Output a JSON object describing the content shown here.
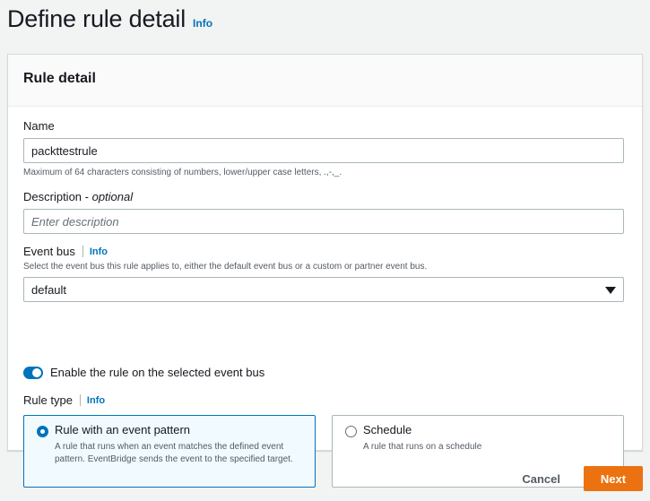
{
  "header": {
    "title": "Define rule detail",
    "info_label": "Info"
  },
  "panel": {
    "title": "Rule detail"
  },
  "name_field": {
    "label": "Name",
    "value": "packttestrule",
    "hint": "Maximum of 64 characters consisting of numbers, lower/upper case letters, .,-,_."
  },
  "description_field": {
    "label": "Description",
    "optional_label": "optional",
    "separator": " - ",
    "placeholder": "Enter description"
  },
  "event_bus": {
    "label": "Event bus",
    "info_label": "Info",
    "hint": "Select the event bus this rule applies to, either the default event bus or a custom or partner event bus.",
    "selected": "default",
    "icon": "caret-down-icon"
  },
  "enable_toggle": {
    "label": "Enable the rule on the selected event bus",
    "checked": true,
    "color": "#0073bb"
  },
  "rule_type": {
    "label": "Rule type",
    "info_label": "Info",
    "options": [
      {
        "title": "Rule with an event pattern",
        "description": "A rule that runs when an event matches the defined event pattern. EventBridge sends the event to the specified target.",
        "selected": true
      },
      {
        "title": "Schedule",
        "description": "A rule that runs on a schedule",
        "selected": false
      }
    ]
  },
  "footer": {
    "cancel_label": "Cancel",
    "next_label": "Next",
    "next_color": "#ec7211"
  }
}
